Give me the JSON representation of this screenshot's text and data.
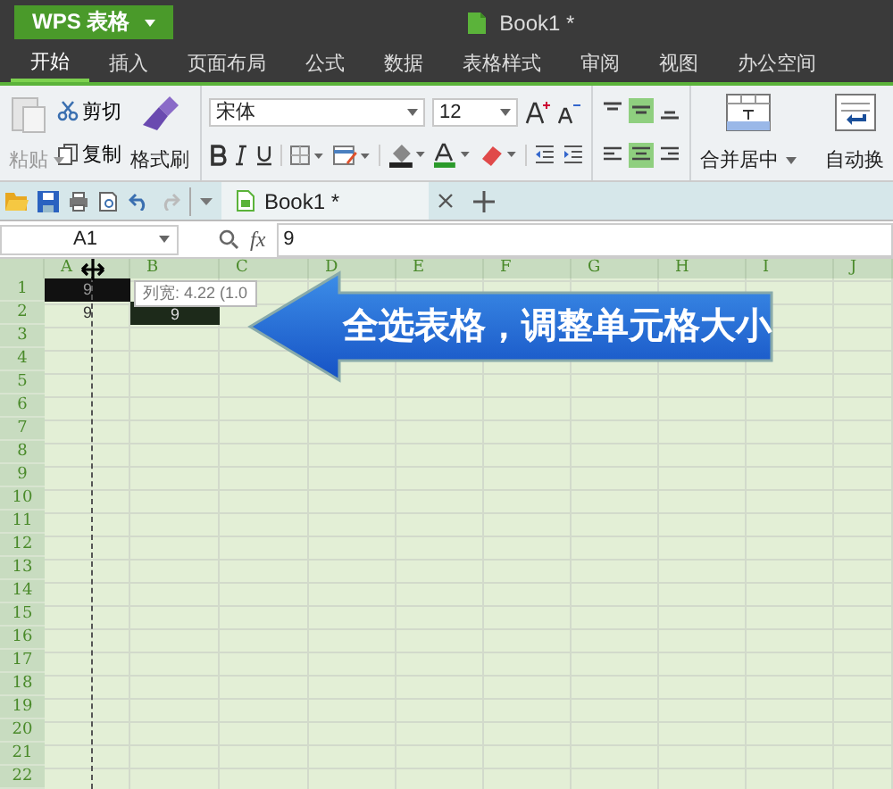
{
  "app_menu": {
    "label": "WPS 表格"
  },
  "window": {
    "title": "Book1 *"
  },
  "tabs": [
    {
      "label": "开始",
      "selected": true
    },
    {
      "label": "插入",
      "selected": false
    },
    {
      "label": "页面布局",
      "selected": false
    },
    {
      "label": "公式",
      "selected": false
    },
    {
      "label": "数据",
      "selected": false
    },
    {
      "label": "表格样式",
      "selected": false
    },
    {
      "label": "审阅",
      "selected": false
    },
    {
      "label": "视图",
      "selected": false
    },
    {
      "label": "办公空间",
      "selected": false
    }
  ],
  "ribbon": {
    "paste": {
      "label": "粘贴",
      "disabled": true
    },
    "cut": "剪切",
    "copy": "复制",
    "format_painter": "格式刷",
    "font": "宋体",
    "font_size": "12",
    "align_vertical": [
      {
        "selected": false
      },
      {
        "selected": true
      },
      {
        "selected": false
      }
    ],
    "align_horizontal": [
      {
        "selected": false
      },
      {
        "selected": true
      },
      {
        "selected": false
      }
    ],
    "merge": "合并居中",
    "wrap": "自动换"
  },
  "document_tab": {
    "label": "Book1 *"
  },
  "formula_bar": {
    "name_box": "A1",
    "fx": "fx",
    "value": "9"
  },
  "sheet": {
    "columns": [
      "A",
      "B",
      "C",
      "D",
      "E",
      "F",
      "G",
      "H",
      "I",
      "J"
    ],
    "rows": [
      {
        "header": "1",
        "cells": [
          {
            "text": "9",
            "selected": true
          }
        ]
      },
      {
        "header": "2",
        "cells": [
          {
            "text": "9",
            "selected": false
          },
          {
            "text": "9",
            "selected": true
          }
        ]
      },
      {
        "header": "3"
      },
      {
        "header": "4"
      },
      {
        "header": "5"
      },
      {
        "header": "6"
      },
      {
        "header": "7"
      },
      {
        "header": "8"
      },
      {
        "header": "9"
      },
      {
        "header": "10"
      },
      {
        "header": "11"
      },
      {
        "header": "12"
      },
      {
        "header": "13"
      },
      {
        "header": "14"
      },
      {
        "header": "15"
      },
      {
        "header": "16"
      },
      {
        "header": "17"
      },
      {
        "header": "18"
      },
      {
        "header": "19"
      },
      {
        "header": "20"
      },
      {
        "header": "21"
      },
      {
        "header": "22"
      }
    ],
    "tooltip": "列宽: 4.22 (1.0"
  },
  "callout": {
    "text": "全选表格，调整单元格大小"
  }
}
